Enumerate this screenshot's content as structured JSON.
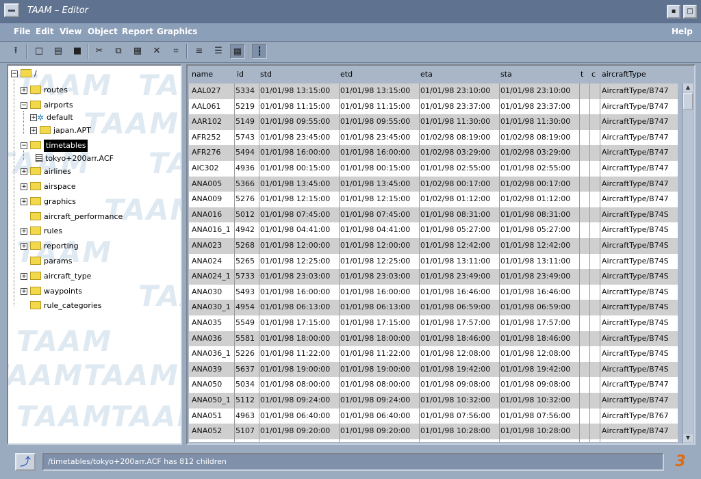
{
  "window": {
    "title": "TAAM – Editor",
    "iconify_glyph": "▪",
    "maximize_glyph": "□"
  },
  "menu": {
    "file": "File",
    "edit": "Edit",
    "view": "View",
    "object": "Object",
    "report": "Report",
    "graphics": "Graphics",
    "help": "Help"
  },
  "toolbar": {
    "icons": {
      "up_folder": "⭱",
      "new": "□",
      "open": "▤",
      "save": "■",
      "cut": "✂",
      "copy": "⧉",
      "paste": "▦",
      "delete": "✕",
      "find": "⌗",
      "rename": "≡",
      "list_view": "☰",
      "table_view": "▦",
      "tree_view": "┇"
    }
  },
  "tree": {
    "root": "/",
    "routes": "routes",
    "airports": "airports",
    "default": "default",
    "japan_apt": "japan.APT",
    "timetables": "timetables",
    "tokyo_file": "tokyo+200arr.ACF",
    "airlines": "airlines",
    "airspace": "airspace",
    "graphics": "graphics",
    "aircraft_performance": "aircraft_performance",
    "rules": "rules",
    "reporting": "reporting",
    "params": "params",
    "aircraft_type": "aircraft_type",
    "waypoints": "waypoints",
    "rule_categories": "rule_categories"
  },
  "table": {
    "headers": {
      "name": "name",
      "id": "id",
      "std": "std",
      "etd": "etd",
      "eta": "eta",
      "sta": "sta",
      "t": "t",
      "c": "c",
      "aircraftType": "aircraftType"
    },
    "rows": [
      [
        "AAL027",
        "5334",
        "01/01/98 13:15:00",
        "01/01/98 13:15:00",
        "01/01/98 23:10:00",
        "01/01/98 23:10:00",
        "AircraftType/B747"
      ],
      [
        "AAL061",
        "5219",
        "01/01/98 11:15:00",
        "01/01/98 11:15:00",
        "01/01/98 23:37:00",
        "01/01/98 23:37:00",
        "AircraftType/B747"
      ],
      [
        "AAR102",
        "5149",
        "01/01/98 09:55:00",
        "01/01/98 09:55:00",
        "01/01/98 11:30:00",
        "01/01/98 11:30:00",
        "AircraftType/B747"
      ],
      [
        "AFR252",
        "5743",
        "01/01/98 23:45:00",
        "01/01/98 23:45:00",
        "01/02/98 08:19:00",
        "01/02/98 08:19:00",
        "AircraftType/B747"
      ],
      [
        "AFR276",
        "5494",
        "01/01/98 16:00:00",
        "01/01/98 16:00:00",
        "01/02/98 03:29:00",
        "01/02/98 03:29:00",
        "AircraftType/B747"
      ],
      [
        "AIC302",
        "4936",
        "01/01/98 00:15:00",
        "01/01/98 00:15:00",
        "01/01/98 02:55:00",
        "01/01/98 02:55:00",
        "AircraftType/B747"
      ],
      [
        "ANA005",
        "5366",
        "01/01/98 13:45:00",
        "01/01/98 13:45:00",
        "01/02/98 00:17:00",
        "01/02/98 00:17:00",
        "AircraftType/B747"
      ],
      [
        "ANA009",
        "5276",
        "01/01/98 12:15:00",
        "01/01/98 12:15:00",
        "01/02/98 01:12:00",
        "01/02/98 01:12:00",
        "AircraftType/B747"
      ],
      [
        "ANA016",
        "5012",
        "01/01/98 07:45:00",
        "01/01/98 07:45:00",
        "01/01/98 08:31:00",
        "01/01/98 08:31:00",
        "AircraftType/B74S"
      ],
      [
        "ANA016_1",
        "4942",
        "01/01/98 04:41:00",
        "01/01/98 04:41:00",
        "01/01/98 05:27:00",
        "01/01/98 05:27:00",
        "AircraftType/B74S"
      ],
      [
        "ANA023",
        "5268",
        "01/01/98 12:00:00",
        "01/01/98 12:00:00",
        "01/01/98 12:42:00",
        "01/01/98 12:42:00",
        "AircraftType/B74S"
      ],
      [
        "ANA024",
        "5265",
        "01/01/98 12:25:00",
        "01/01/98 12:25:00",
        "01/01/98 13:11:00",
        "01/01/98 13:11:00",
        "AircraftType/B74S"
      ],
      [
        "ANA024_1",
        "5733",
        "01/01/98 23:03:00",
        "01/01/98 23:03:00",
        "01/01/98 23:49:00",
        "01/01/98 23:49:00",
        "AircraftType/B74S"
      ],
      [
        "ANA030",
        "5493",
        "01/01/98 16:00:00",
        "01/01/98 16:00:00",
        "01/01/98 16:46:00",
        "01/01/98 16:46:00",
        "AircraftType/B74S"
      ],
      [
        "ANA030_1",
        "4954",
        "01/01/98 06:13:00",
        "01/01/98 06:13:00",
        "01/01/98 06:59:00",
        "01/01/98 06:59:00",
        "AircraftType/B74S"
      ],
      [
        "ANA035",
        "5549",
        "01/01/98 17:15:00",
        "01/01/98 17:15:00",
        "01/01/98 17:57:00",
        "01/01/98 17:57:00",
        "AircraftType/B74S"
      ],
      [
        "ANA036",
        "5581",
        "01/01/98 18:00:00",
        "01/01/98 18:00:00",
        "01/01/98 18:46:00",
        "01/01/98 18:46:00",
        "AircraftType/B74S"
      ],
      [
        "ANA036_1",
        "5226",
        "01/01/98 11:22:00",
        "01/01/98 11:22:00",
        "01/01/98 12:08:00",
        "01/01/98 12:08:00",
        "AircraftType/B74S"
      ],
      [
        "ANA039",
        "5637",
        "01/01/98 19:00:00",
        "01/01/98 19:00:00",
        "01/01/98 19:42:00",
        "01/01/98 19:42:00",
        "AircraftType/B74S"
      ],
      [
        "ANA050",
        "5034",
        "01/01/98 08:00:00",
        "01/01/98 08:00:00",
        "01/01/98 09:08:00",
        "01/01/98 09:08:00",
        "AircraftType/B747"
      ],
      [
        "ANA050_1",
        "5112",
        "01/01/98 09:24:00",
        "01/01/98 09:24:00",
        "01/01/98 10:32:00",
        "01/01/98 10:32:00",
        "AircraftType/B747"
      ],
      [
        "ANA051",
        "4963",
        "01/01/98 06:40:00",
        "01/01/98 06:40:00",
        "01/01/98 07:56:00",
        "01/01/98 07:56:00",
        "AircraftType/B767"
      ],
      [
        "ANA052",
        "5107",
        "01/01/98 09:20:00",
        "01/01/98 09:20:00",
        "01/01/98 10:28:00",
        "01/01/98 10:28:00",
        "AircraftType/B747"
      ]
    ]
  },
  "status": {
    "text": "/timetables/tokyo+200arr.ACF has 812 children",
    "left_icon": "⤴",
    "right_icon": "3"
  },
  "colors": {
    "selection": "#000000",
    "folder": "#f2d94c",
    "row_alt": "#cfcfcf",
    "status_field": "#7e90aa"
  }
}
